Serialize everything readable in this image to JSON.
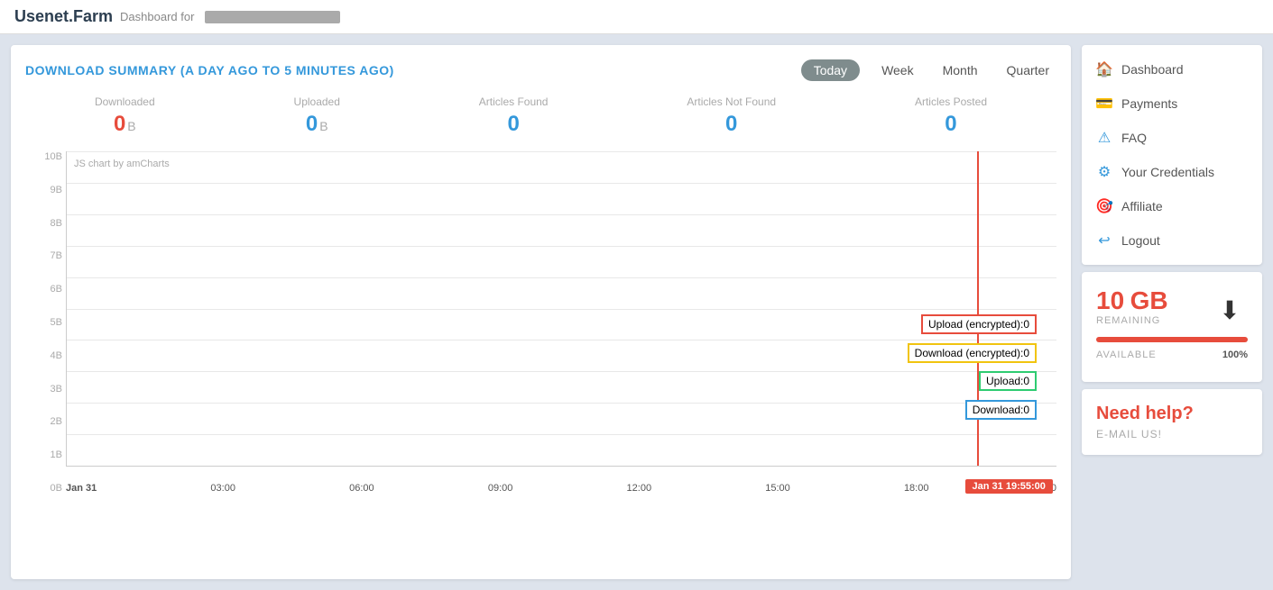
{
  "header": {
    "logo_text": "Usenet.Farm",
    "dashboard_for_label": "Dashboard for",
    "user_bar_placeholder": ""
  },
  "content": {
    "title": "DOWNLOAD SUMMARY (A DAY AGO TO 5 MINUTES AGO)",
    "time_filters": [
      {
        "label": "Today",
        "active": true
      },
      {
        "label": "Week",
        "active": false
      },
      {
        "label": "Month",
        "active": false
      },
      {
        "label": "Quarter",
        "active": false
      }
    ],
    "stats": [
      {
        "label": "Downloaded",
        "value": "0",
        "unit": "B",
        "color": "red"
      },
      {
        "label": "Uploaded",
        "value": "0",
        "unit": "B",
        "color": "blue"
      },
      {
        "label": "Articles Found",
        "value": "0",
        "unit": "",
        "color": "blue"
      },
      {
        "label": "Articles Not Found",
        "value": "0",
        "unit": "",
        "color": "blue"
      },
      {
        "label": "Articles Posted",
        "value": "0",
        "unit": "",
        "color": "blue"
      }
    ],
    "chart": {
      "brand_text": "JS chart by amCharts",
      "y_labels": [
        "0B",
        "1B",
        "2B",
        "3B",
        "4B",
        "5B",
        "6B",
        "7B",
        "8B",
        "9B",
        "10B"
      ],
      "x_labels": [
        {
          "text": "Jan 31",
          "bold": true
        },
        {
          "text": "03:00",
          "bold": false
        },
        {
          "text": "06:00",
          "bold": false
        },
        {
          "text": "09:00",
          "bold": false
        },
        {
          "text": "12:00",
          "bold": false
        },
        {
          "text": "15:00",
          "bold": false
        },
        {
          "text": "18:00",
          "bold": false
        },
        {
          "text": ":00",
          "bold": false
        }
      ],
      "tooltips": [
        {
          "label": "Upload (encrypted):0",
          "border_color": "#e74c3c"
        },
        {
          "label": "Download (encrypted):0",
          "border_color": "#f1c40f"
        },
        {
          "label": "Upload:0",
          "border_color": "#2ecc71"
        },
        {
          "label": "Download:0",
          "border_color": "#3498db"
        }
      ],
      "date_tooltip": "Jan 31 19:55:00",
      "vline_position_pct": 92
    }
  },
  "sidebar": {
    "nav_items": [
      {
        "label": "Dashboard",
        "icon": "🏠"
      },
      {
        "label": "Payments",
        "icon": "💳"
      },
      {
        "label": "FAQ",
        "icon": "⚠"
      },
      {
        "label": "Your Credentials",
        "icon": "⚙"
      },
      {
        "label": "Affiliate",
        "icon": "🎯"
      },
      {
        "label": "Logout",
        "icon": "↩"
      }
    ],
    "storage": {
      "amount": "10",
      "unit": "GB",
      "remaining_label": "REMAINING",
      "available_label": "AVAILABLE",
      "available_pct": "100%",
      "bar_width_pct": 100
    },
    "help": {
      "title": "Need help?",
      "subtitle": "E-MAIL US!"
    }
  }
}
